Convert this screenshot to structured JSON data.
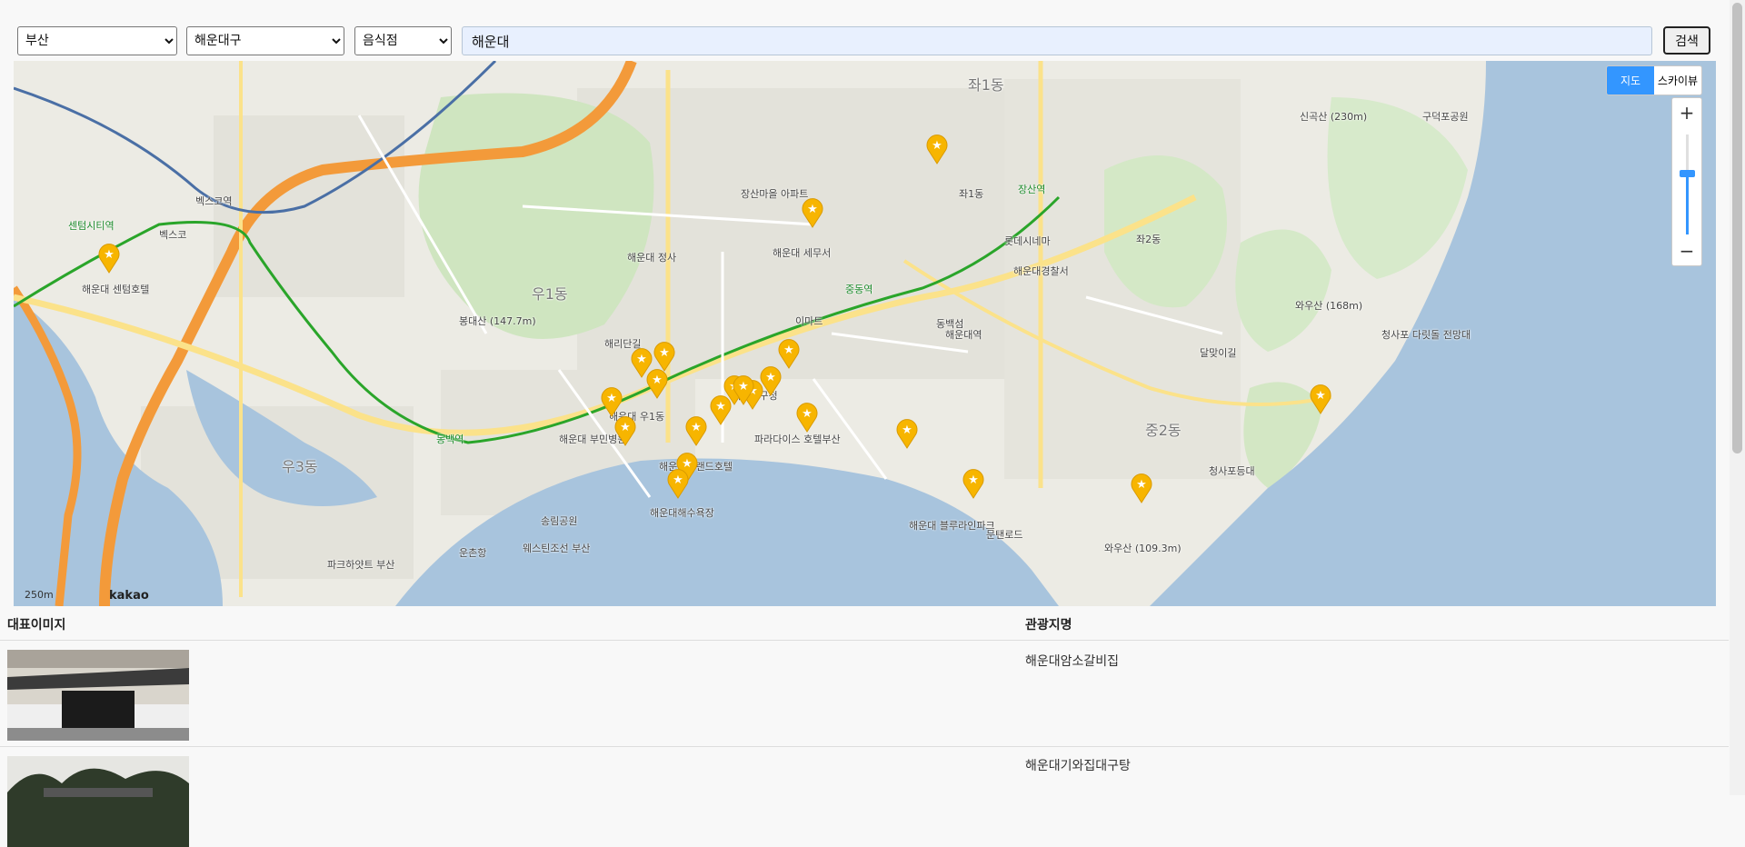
{
  "search": {
    "city": "부산",
    "district": "해운대구",
    "category": "음식점",
    "keyword": "해운대",
    "button_label": "검색"
  },
  "map": {
    "type_controls": [
      "지도",
      "스카이뷰"
    ],
    "zoom_in": "+",
    "zoom_out": "−",
    "scale": "250m",
    "logo": "kakao",
    "marker_icon": "star-marker-icon",
    "marker_color": "#f7b500",
    "labels": [
      "파크하얏트 부산",
      "해운대역",
      "중동역",
      "장산역",
      "벡스코역",
      "센텀시티역",
      "동백역",
      "해운대해수욕장",
      "해운대 블루라인파크",
      "동백섬",
      "와우산 (168m)",
      "와우산 (109.3m)",
      "장산마을 아파트",
      "해운대구청",
      "해운대 센텀호텔",
      "이마트",
      "해운대경찰서",
      "청사포 다릿돌 전망대",
      "해운대 우1동",
      "좌1동",
      "좌2동",
      "중2동",
      "우1동",
      "우3동",
      "좌1동",
      "해리단길",
      "웨스틴조선 부산",
      "파라다이스 호텔부산",
      "해운대그랜드호텔",
      "롯데시네마",
      "해운대 부민병원",
      "해운대 세무서",
      "해운대 정사",
      "봉대산 (147.7m)",
      "벡스코",
      "운촌항",
      "송림공원",
      "문탠로드",
      "청사포등대",
      "달맞이길",
      "구덕포공원",
      "신곡산 (230m)"
    ]
  },
  "table": {
    "headers": [
      "대표이미지",
      "관광지명"
    ],
    "rows": [
      {
        "title": "해운대암소갈비집"
      },
      {
        "title": "해운대기와집대구탕"
      }
    ]
  }
}
